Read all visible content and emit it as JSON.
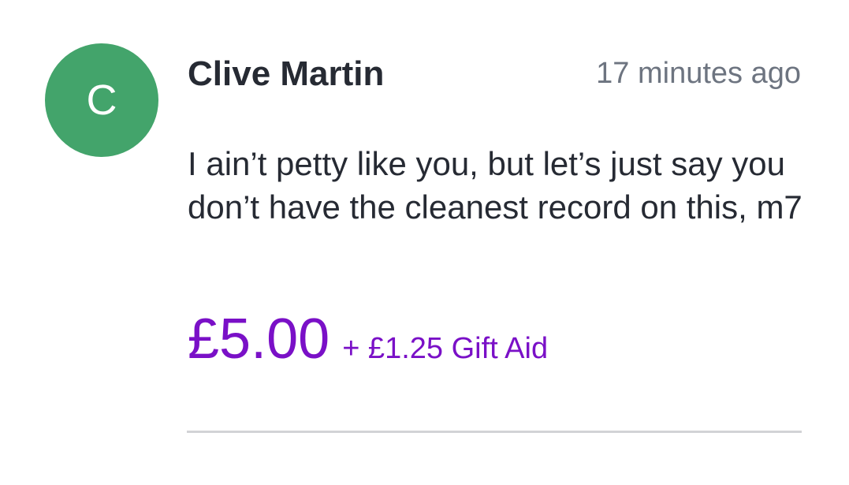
{
  "donation": {
    "avatar_initial": "C",
    "avatar_color": "#43a46b",
    "donor_name": "Clive Martin",
    "timestamp": "17 minutes ago",
    "message": "I ain’t petty like you, but let’s just say you don’t have the cleanest record on this, m7",
    "amount": "£5.00",
    "gift_aid": "+ £1.25 Gift Aid",
    "accent_color": "#7a10c7"
  }
}
